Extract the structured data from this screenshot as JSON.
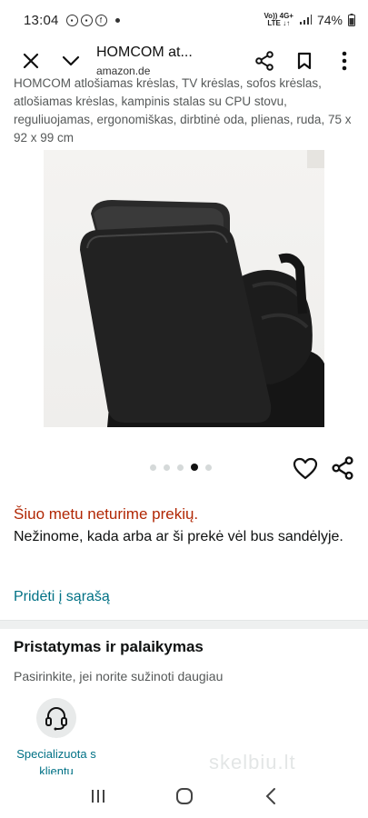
{
  "status_bar": {
    "time": "13:04",
    "network_top": "Vo)) 4G+",
    "network_bottom": "LTE ↓↑",
    "battery": "74%"
  },
  "header": {
    "title": "HOMCOM at...",
    "subtitle": "amazon.de"
  },
  "product": {
    "description": "HOMCOM atlošiamas krėslas, TV krėslas, sofos krėslas, atlošiamas krėslas, kampinis stalas su CPU stovu, reguliuojamas, ergonomiškas, dirbtinė oda, plienas, ruda, 75 x 92 x 99 cm",
    "carousel": {
      "total": 5,
      "active_index": 3
    },
    "out_of_stock": "Šiuo metu neturime prekių.",
    "out_of_stock_note": "Nežinome, kada arba ar ši prekė vėl bus sandėlyje.",
    "add_to_list": "Pridėti į sąrašą"
  },
  "delivery": {
    "title": "Pristatymas ir palaikymas",
    "subtitle": "Pasirinkite, jei norite sužinoti daugiau",
    "support_label": "Specializuota s klientu"
  },
  "watermark": "skelbiu.lt",
  "icons": {
    "close": "close-icon",
    "chevron": "chevron-down-icon",
    "share": "share-icon",
    "bookmark": "bookmark-icon",
    "heart": "heart-icon",
    "headset": "headset-icon"
  },
  "colors": {
    "out_of_stock": "#b12704",
    "link": "#007185"
  }
}
